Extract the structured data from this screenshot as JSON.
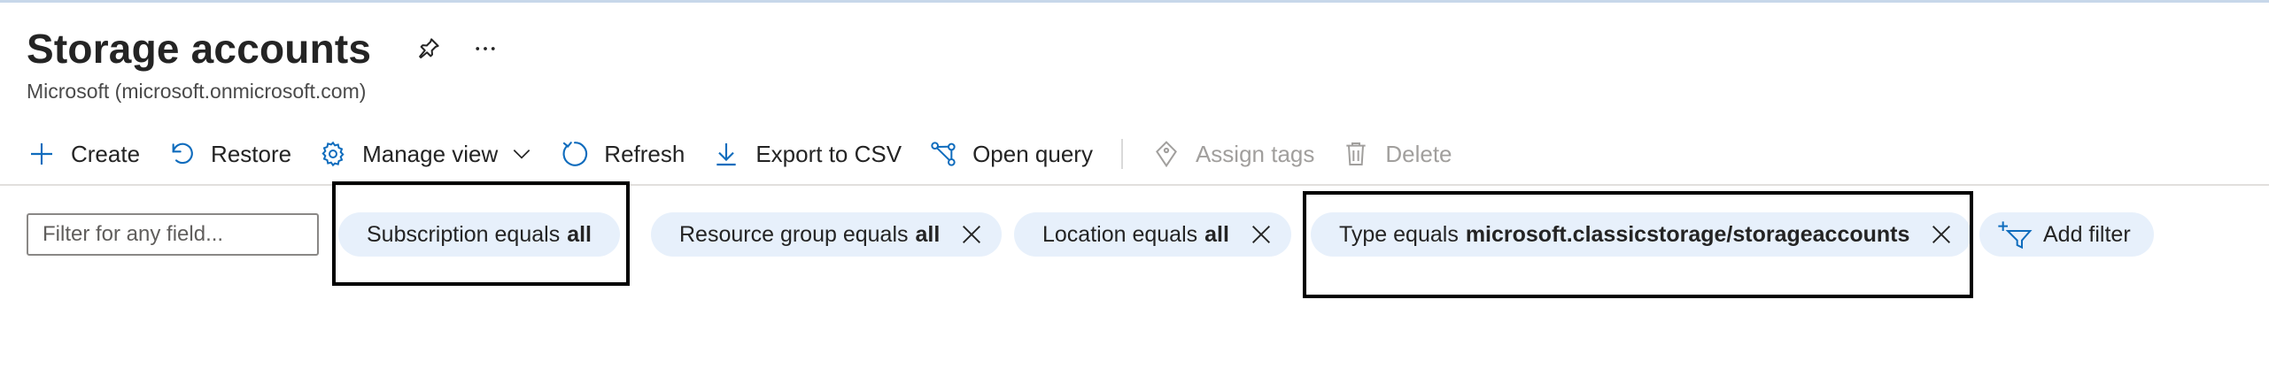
{
  "header": {
    "title": "Storage accounts",
    "subtitle": "Microsoft (microsoft.onmicrosoft.com)",
    "pin_icon": "pin-icon",
    "more_icon": "more-ellipsis-icon"
  },
  "toolbar": {
    "create": "Create",
    "restore": "Restore",
    "manage_view": "Manage view",
    "refresh": "Refresh",
    "export_csv": "Export to CSV",
    "open_query": "Open query",
    "assign_tags": "Assign tags",
    "delete": "Delete"
  },
  "filters": {
    "placeholder": "Filter for any field...",
    "subscription": {
      "label": "Subscription equals",
      "value": "all"
    },
    "resource_group": {
      "label": "Resource group equals",
      "value": "all"
    },
    "location": {
      "label": "Location equals",
      "value": "all"
    },
    "type": {
      "label": "Type equals",
      "value": "microsoft.classicstorage/storageaccounts"
    },
    "add_filter": "Add filter"
  },
  "colors": {
    "accent": "#0f6cbd",
    "pill_bg": "#e7f0fb",
    "disabled": "#a19f9d",
    "highlight_box": "#000000"
  }
}
